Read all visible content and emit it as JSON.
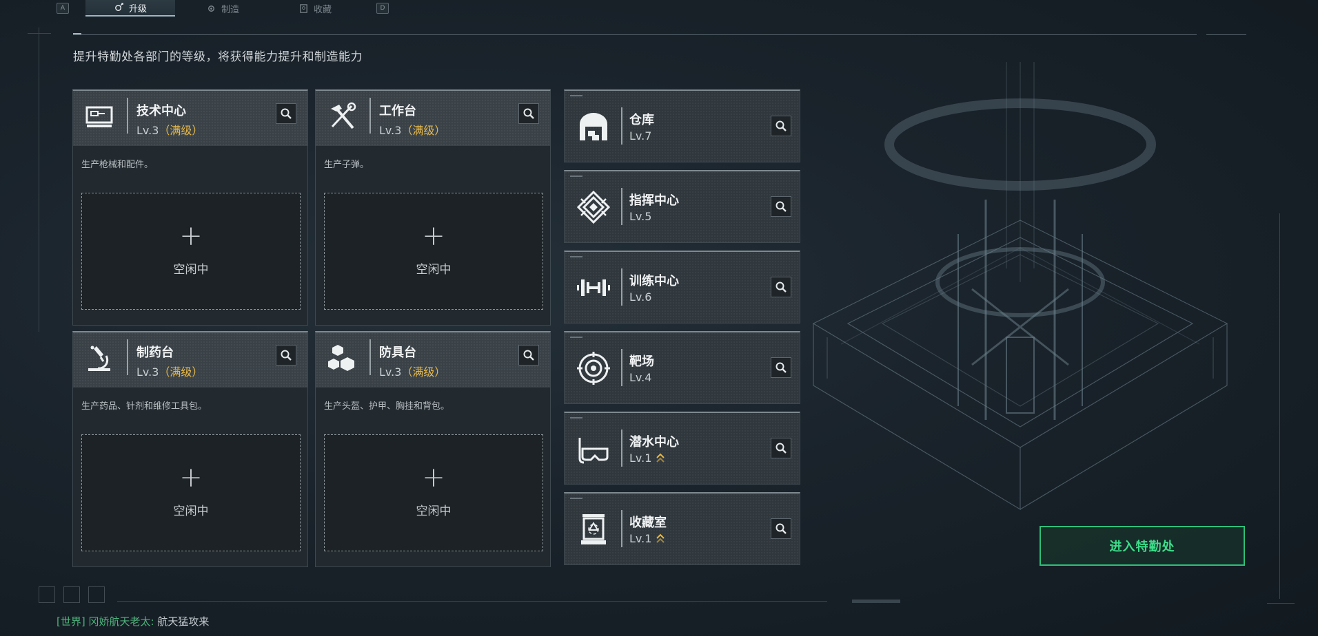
{
  "tabs": {
    "left_key": "A",
    "right_key": "D",
    "items": [
      {
        "label": "升级",
        "active": true
      },
      {
        "label": "制造",
        "active": false
      },
      {
        "label": "收藏",
        "active": false
      }
    ]
  },
  "subtitle": "提升特勤处各部门的等级，将获得能力提升和制造能力",
  "cards": [
    {
      "name": "技术中心",
      "level": "Lv.3",
      "max": "（满级）",
      "desc": "生产枪械和配件。",
      "slot_label": "空闲中",
      "icon": "computer-icon"
    },
    {
      "name": "工作台",
      "level": "Lv.3",
      "max": "（满级）",
      "desc": "生产子弹。",
      "slot_label": "空闲中",
      "icon": "hammer-wrench-icon"
    },
    {
      "name": "制药台",
      "level": "Lv.3",
      "max": "（满级）",
      "desc": "生产药品、针剂和维修工具包。",
      "slot_label": "空闲中",
      "icon": "microscope-icon"
    },
    {
      "name": "防具台",
      "level": "Lv.3",
      "max": "（满级）",
      "desc": "生产头盔、护甲、胸挂和背包。",
      "slot_label": "空闲中",
      "icon": "boxes-icon"
    }
  ],
  "facilities": [
    {
      "name": "仓库",
      "level": "Lv.7",
      "upgradable": false,
      "icon": "warehouse-icon"
    },
    {
      "name": "指挥中心",
      "level": "Lv.5",
      "upgradable": false,
      "icon": "command-emblem-icon"
    },
    {
      "name": "训练中心",
      "level": "Lv.6",
      "upgradable": false,
      "icon": "dumbbell-icon"
    },
    {
      "name": "靶场",
      "level": "Lv.4",
      "upgradable": false,
      "icon": "target-icon"
    },
    {
      "name": "潜水中心",
      "level": "Lv.1",
      "upgradable": true,
      "icon": "diving-mask-icon"
    },
    {
      "name": "收藏室",
      "level": "Lv.1",
      "upgradable": true,
      "icon": "collection-case-icon"
    }
  ],
  "enter_button": "进入特勤处",
  "chat": {
    "channel": "[世界]",
    "sender": "冈娇航天老太:",
    "message": "航天猛攻来"
  },
  "colors": {
    "accent_green": "#2fbf7a",
    "max_level_gold": "#e6b84a",
    "background": "#1a232b"
  }
}
